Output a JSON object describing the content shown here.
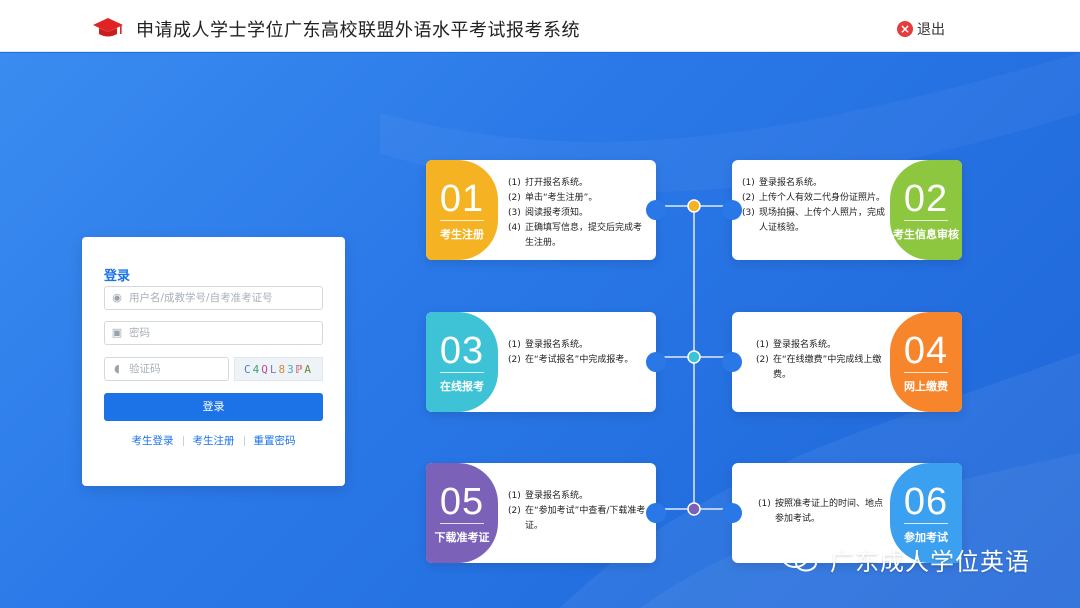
{
  "header": {
    "title": "申请成人学士学位广东高校联盟外语水平考试报考系统",
    "logout_label": "退出"
  },
  "login": {
    "title": "登录",
    "username_placeholder": "用户名/成教学号/自考准考证号",
    "password_placeholder": "密码",
    "captcha_placeholder": "验证码",
    "captcha_text": "C4QL83ℙA",
    "submit_label": "登录",
    "links": [
      "考生登录",
      "考生注册",
      "重置密码"
    ]
  },
  "steps": [
    {
      "num": "01",
      "label": "考生注册",
      "color": "#f5b324",
      "lines": [
        [
          "(1)",
          "打开报名系统。"
        ],
        [
          "(2)",
          "单击“考生注册”。"
        ],
        [
          "(3)",
          "阅读报考须知。"
        ],
        [
          "(4)",
          "正确填写信息，提交后完成考生注册。"
        ]
      ]
    },
    {
      "num": "02",
      "label": "考生信息审核",
      "color": "#8dc63f",
      "lines": [
        [
          "(1)",
          "登录报名系统。"
        ],
        [
          "(2)",
          "上传个人有效二代身份证照片。"
        ],
        [
          "(3)",
          "现场拍摄、上传个人照片，完成人证核验。"
        ]
      ]
    },
    {
      "num": "03",
      "label": "在线报考",
      "color": "#3ec3d6",
      "lines": [
        [
          "(1)",
          "登录报名系统。"
        ],
        [
          "(2)",
          "在“考试报名”中完成报考。"
        ]
      ]
    },
    {
      "num": "04",
      "label": "网上缴费",
      "color": "#f7852b",
      "lines": [
        [
          "(1)",
          "登录报名系统。"
        ],
        [
          "(2)",
          "在“在线缴费”中完成线上缴费。"
        ]
      ]
    },
    {
      "num": "05",
      "label": "下载准考证",
      "color": "#7b62b8",
      "lines": [
        [
          "(1)",
          "登录报名系统。"
        ],
        [
          "(2)",
          "在“参加考试”中查看/下载准考证。"
        ]
      ]
    },
    {
      "num": "06",
      "label": "参加考试",
      "color": "#3ba0f0",
      "lines": [
        [
          "(1)",
          "按照准考证上的时间、地点参加考试。"
        ]
      ]
    }
  ],
  "timeline_dot_colors": [
    "#f5b324",
    "#3ec3d6",
    "#7b62b8"
  ],
  "watermark": {
    "text": "广东成人学位英语",
    "icon": "wechat-icon"
  }
}
